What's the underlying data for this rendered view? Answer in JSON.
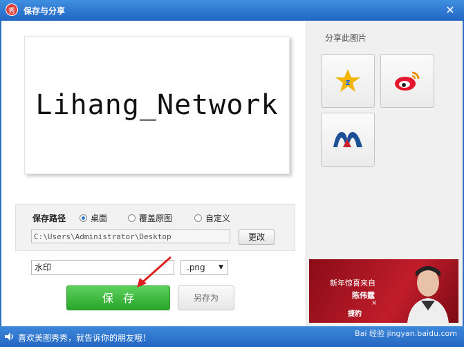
{
  "window": {
    "app_icon_glyph": "秀",
    "title": "保存与分享",
    "close_symbol": "✕"
  },
  "preview": {
    "image_text": "Lihang_Network"
  },
  "save": {
    "path_label": "保存路径",
    "options": [
      "桌面",
      "覆盖原图",
      "自定义"
    ],
    "selected_option": "桌面",
    "path_value": "C:\\Users\\Administrator\\Desktop",
    "change_label": "更改",
    "watermark_value": "水印",
    "format_value": ".png",
    "save_label": "保存",
    "saveas_label": "另存为"
  },
  "share": {
    "title": "分享此图片",
    "targets": [
      {
        "name": "qzone",
        "icon": "qzone-star-icon"
      },
      {
        "name": "weibo",
        "icon": "weibo-icon"
      },
      {
        "name": "renren",
        "icon": "renren-icon"
      }
    ]
  },
  "ad": {
    "line1": "新年惊喜来自",
    "name": "陈伟霆",
    "x": "×",
    "brand": "捷豹"
  },
  "status": {
    "text": "喜欢美图秀秀，就告诉你的朋友哦！",
    "watermark": "Bai 经验 jingyan.baidu.com"
  },
  "colors": {
    "accent_blue": "#2a70c6",
    "save_green": "#36b036",
    "annotation_red": "#e02020"
  }
}
